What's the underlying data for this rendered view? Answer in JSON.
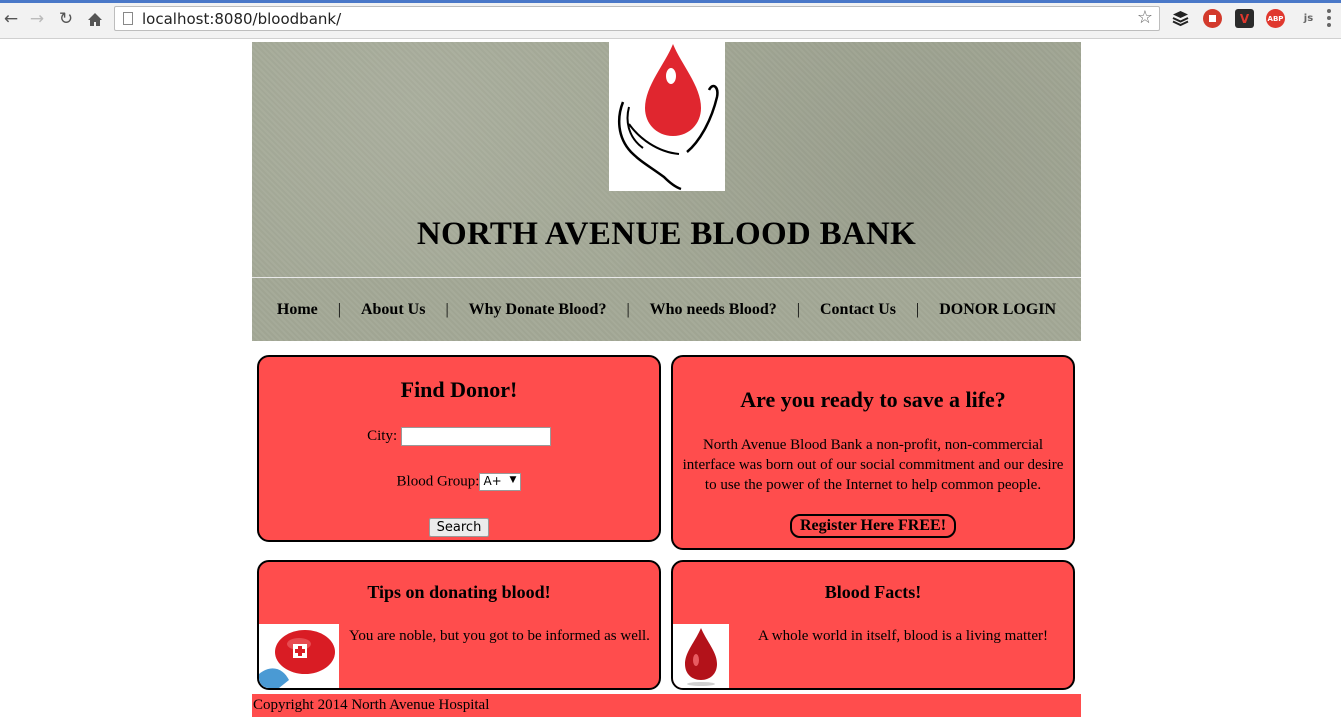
{
  "browser": {
    "url": "localhost:8080/bloodbank/",
    "back_icon": "back-arrow-icon",
    "forward_icon": "forward-arrow-icon",
    "reload_icon": "reload-icon",
    "home_icon": "home-icon",
    "extensions": [
      {
        "name": "buffer-icon",
        "color": "#222222",
        "label": ""
      },
      {
        "name": "stop-icon",
        "color": "#d33a2c",
        "label": ""
      },
      {
        "name": "vivaldi-icon",
        "color": "#2b2b2b",
        "label": "V"
      },
      {
        "name": "adblock-plus-icon",
        "color": "#e0382e",
        "label": "ABP"
      },
      {
        "name": "js-icon",
        "color": "#7a7a7a",
        "label": "js"
      }
    ]
  },
  "header": {
    "title": "NORTH AVENUE BLOOD BANK"
  },
  "nav": {
    "items": [
      "Home",
      "About Us",
      "Why Donate Blood?",
      "Who needs Blood?",
      "Contact Us",
      "DONOR LOGIN"
    ],
    "separator": "|"
  },
  "find_donor": {
    "title": "Find Donor!",
    "city_label": "City:",
    "city_value": "",
    "blood_group_label": "Blood Group:",
    "blood_group_value": "A+",
    "search_label": "Search"
  },
  "save_life": {
    "title": "Are you ready to save a life?",
    "text": "North Avenue Blood Bank a non-profit, non-commercial interface was born out of our social commitment and our desire to use the power of the Internet to help common people.",
    "register_label": "Register Here FREE!"
  },
  "tips": {
    "title": "Tips on donating blood!",
    "text": "You are noble, but you got to be informed as well."
  },
  "facts": {
    "title": "Blood Facts!",
    "text": "A whole world in itself, blood is a living matter!"
  },
  "footer": {
    "text": "Copyright 2014 North Avenue Hospital"
  },
  "colors": {
    "accent": "#ff4d4d",
    "header_bg": "#a3a896"
  }
}
